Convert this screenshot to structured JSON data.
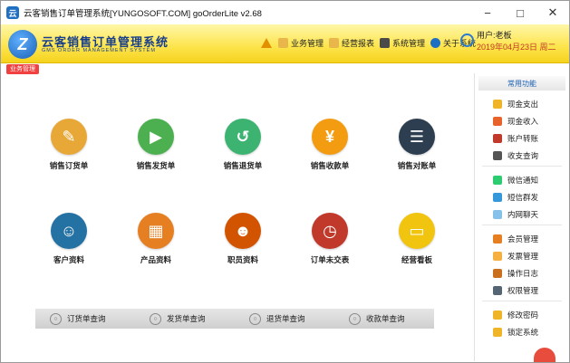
{
  "window": {
    "title": "云客销售订单管理系统[YUNGOSOFT.COM] goOrderLite v2.68",
    "controls": [
      "−",
      "□",
      "✕"
    ]
  },
  "header": {
    "logo_letter": "Z",
    "logo_title": "云客销售订单管理系统",
    "logo_subtitle": "GMS ORDER MANAGEMENT SYSTEM",
    "menu": [
      {
        "label": "业务管理",
        "icon": "folder-icon",
        "color": "#e8b64a"
      },
      {
        "label": "经营报表",
        "icon": "folder-icon",
        "color": "#e8b64a"
      },
      {
        "label": "系统管理",
        "icon": "document-icon",
        "color": "#4a4a4a"
      },
      {
        "label": "关于系统",
        "icon": "help-icon",
        "color": "#1f6fc2"
      }
    ],
    "user_label": "用户:老板",
    "date": "2019年04月23日 周二"
  },
  "tag": "业务管理",
  "main_items": [
    {
      "label": "销售订货单",
      "icon": "edit-order-icon",
      "color": "#e8a838",
      "glyph": "✎"
    },
    {
      "label": "销售发货单",
      "icon": "delivery-truck-icon",
      "color": "#4cb050",
      "glyph": "▶"
    },
    {
      "label": "销售退货单",
      "icon": "return-icon",
      "color": "#3cb371",
      "glyph": "↺"
    },
    {
      "label": "销售收款单",
      "icon": "yuan-icon",
      "color": "#f39c12",
      "glyph": "¥"
    },
    {
      "label": "销售对账单",
      "icon": "clipboard-icon",
      "color": "#2c3e50",
      "glyph": "☰"
    },
    {
      "label": "客户资料",
      "icon": "customer-icon",
      "color": "#2471a3",
      "glyph": "☺"
    },
    {
      "label": "产品资料",
      "icon": "product-icon",
      "color": "#e67e22",
      "glyph": "▦"
    },
    {
      "label": "职员资料",
      "icon": "employee-icon",
      "color": "#d35400",
      "glyph": "☻"
    },
    {
      "label": "订单未交表",
      "icon": "order-pending-icon",
      "color": "#c0392b",
      "glyph": "◷"
    },
    {
      "label": "经营看板",
      "icon": "dashboard-icon",
      "color": "#f1c40f",
      "glyph": "▭"
    }
  ],
  "query_bar": [
    {
      "label": "订货单查询"
    },
    {
      "label": "发货单查询"
    },
    {
      "label": "退货单查询"
    },
    {
      "label": "收款单查询"
    }
  ],
  "sidebar": {
    "title": "常用功能",
    "groups": [
      [
        {
          "label": "现金支出",
          "icon": "cash-out-icon",
          "color": "#f0b429"
        },
        {
          "label": "现金收入",
          "icon": "cash-in-icon",
          "color": "#e8632b"
        },
        {
          "label": "账户转账",
          "icon": "transfer-icon",
          "color": "#c0392b"
        },
        {
          "label": "收支查询",
          "icon": "query-icon",
          "color": "#555555"
        }
      ],
      [
        {
          "label": "微信通知",
          "icon": "wechat-icon",
          "color": "#2ecc71"
        },
        {
          "label": "短信群发",
          "icon": "sms-icon",
          "color": "#3498db"
        },
        {
          "label": "内网聊天",
          "icon": "chat-icon",
          "color": "#85c1e9"
        }
      ],
      [
        {
          "label": "会员管理",
          "icon": "member-icon",
          "color": "#e67e22"
        },
        {
          "label": "发票管理",
          "icon": "invoice-icon",
          "color": "#f5b041"
        },
        {
          "label": "操作日志",
          "icon": "log-icon",
          "color": "#ca6f1e"
        },
        {
          "label": "权限管理",
          "icon": "permission-icon",
          "color": "#566573"
        }
      ],
      [
        {
          "label": "修改密码",
          "icon": "key-icon",
          "color": "#f0b429"
        },
        {
          "label": "锁定系统",
          "icon": "lock-icon",
          "color": "#f0b429"
        }
      ]
    ]
  }
}
